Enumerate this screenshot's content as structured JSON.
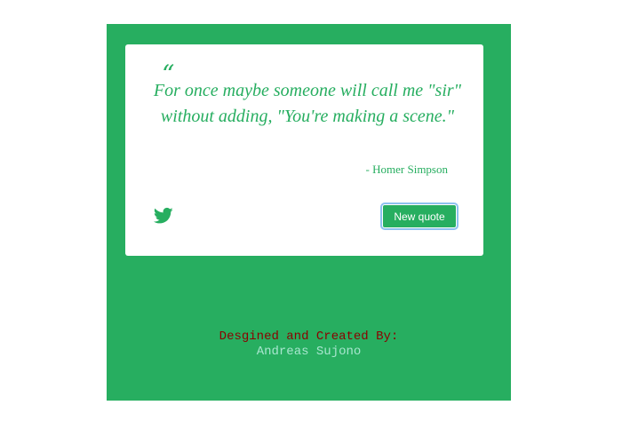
{
  "colors": {
    "accent": "#27ae60",
    "card": "#ffffff",
    "credit_label": "#8b0000",
    "credit_name": "#a8e6cf"
  },
  "quote": {
    "open_mark": "“",
    "text": "For once maybe someone will call me \"sir\" without adding, \"You're making a scene.\"",
    "author": "- Homer Simpson"
  },
  "actions": {
    "tweet_icon": "twitter-icon",
    "new_quote_label": "New quote"
  },
  "footer": {
    "label": "Desgined and Created By:",
    "name": "Andreas Sujono"
  }
}
